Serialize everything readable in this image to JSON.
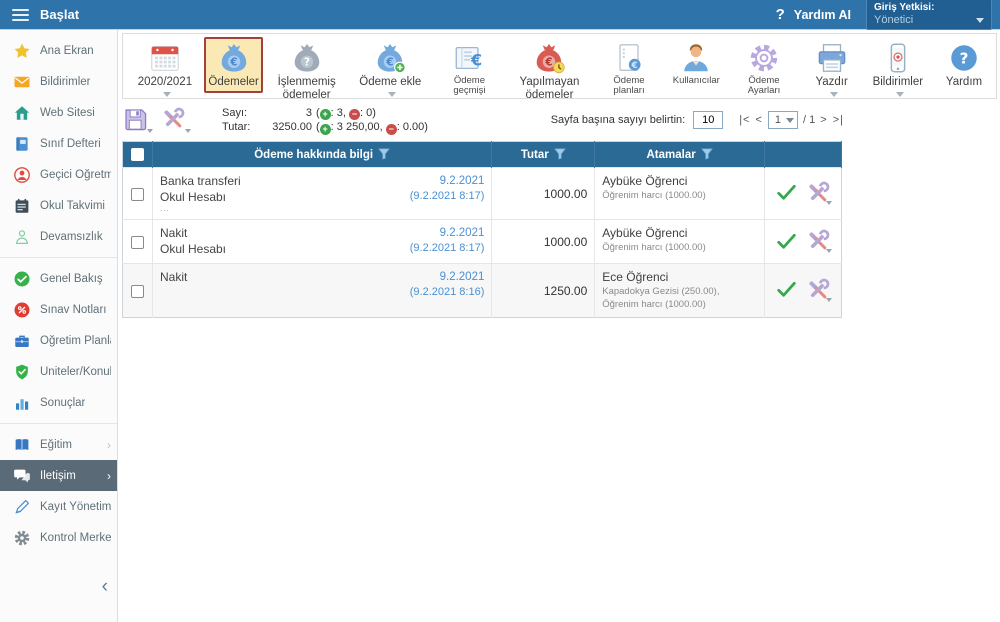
{
  "topbar": {
    "menu_label": "Başlat",
    "help_label": "Yardım AI",
    "role_label": "Giriş Yetkisi:",
    "role_value": "Yönetici"
  },
  "sidebar": {
    "collapse_glyph": "‹",
    "items": [
      {
        "id": "ana-ekran",
        "label": "Ana Ekran",
        "icon": "star-icon"
      },
      {
        "id": "bildirimler",
        "label": "Bildirimler",
        "icon": "mail-icon"
      },
      {
        "id": "web-sitesi",
        "label": "Web Sitesi",
        "icon": "home-icon"
      },
      {
        "id": "sinif-defteri",
        "label": "Sınıf Defteri",
        "icon": "notebook-icon"
      },
      {
        "id": "gecici-ogretmen",
        "label": "Geçici Öğretm...",
        "icon": "person-circle-icon"
      },
      {
        "id": "okul-takvimi",
        "label": "Okul Takvimi",
        "icon": "calendar-dark-icon"
      },
      {
        "id": "devamsizlik",
        "label": "Devamsızlık",
        "icon": "person-outline-icon",
        "divider_after": true
      },
      {
        "id": "genel-bakis",
        "label": "Genel Bakış",
        "icon": "check-circle-icon"
      },
      {
        "id": "sinav-notlari",
        "label": "Sınav Notları",
        "icon": "percent-circle-icon"
      },
      {
        "id": "ogretim-planlari",
        "label": "Öğretim Planları",
        "icon": "briefcase-icon"
      },
      {
        "id": "uniteler-konular",
        "label": "Üniteler/Konular",
        "icon": "shield-check-icon"
      },
      {
        "id": "sonuclar",
        "label": "Sonuçlar",
        "icon": "bar-chart-icon",
        "divider_after": true
      },
      {
        "id": "egitim",
        "label": "Eğitim",
        "icon": "open-book-icon",
        "chevron": true
      },
      {
        "id": "iletisim",
        "label": "İletişim",
        "icon": "chat-icon",
        "chevron": true,
        "selected": true
      },
      {
        "id": "kayit-yonetimi",
        "label": "Kayıt Yönetimi",
        "icon": "pen-icon"
      },
      {
        "id": "kontrol-merkezi",
        "label": "Kontrol Merkezi",
        "icon": "gear-gray-icon"
      }
    ]
  },
  "toolbar": {
    "items": [
      {
        "id": "year",
        "label": "2020/2021",
        "icon": "calendar-icon",
        "arrow": true
      },
      {
        "id": "odemeler",
        "label": "Ödemeler",
        "icon": "moneybag-euro-icon",
        "active": true
      },
      {
        "id": "islenmemis-odemeler",
        "label": "İşlenmemiş ödemeler",
        "icon": "moneybag-question-icon"
      },
      {
        "id": "odeme-ekle",
        "label": "Ödeme ekle",
        "icon": "moneybag-add-icon",
        "arrow": true
      },
      {
        "id": "odeme-gecmisi",
        "label": "Ödeme geçmişi",
        "icon": "ledger-euro-icon",
        "small": true
      },
      {
        "id": "yapilmayan-odemeler",
        "label": "Yapılmayan ödemeler",
        "icon": "moneybag-overdue-icon"
      },
      {
        "id": "odeme-planlari",
        "label": "Ödeme planları",
        "icon": "document-euro-icon",
        "small": true
      },
      {
        "id": "kullanicilar",
        "label": "Kullanıcılar",
        "icon": "user-icon",
        "small": true
      },
      {
        "id": "odeme-ayarlari",
        "label": "Ödeme Ayarları",
        "icon": "gear-purple-icon",
        "small": true
      },
      {
        "id": "yazdir",
        "label": "Yazdır",
        "icon": "printer-icon",
        "arrow": true
      },
      {
        "id": "bildirimler-tb",
        "label": "Bildirimler",
        "icon": "phone-icon",
        "arrow": true
      },
      {
        "id": "yardim",
        "label": "Yardım",
        "icon": "help-circle-icon"
      }
    ]
  },
  "controls": {
    "summary": {
      "sayi_label": "Sayı:",
      "sayi_value": "3",
      "sayi_pos": "3",
      "sayi_neg": "0",
      "tutar_label": "Tutar:",
      "tutar_value": "3250.00",
      "tutar_pos": "3 250,00",
      "tutar_neg": "0.00",
      "plus": "+",
      "minus": "−",
      "open_paren": "(",
      "close_paren": ")",
      "colon": ":",
      "comma": ","
    },
    "pagination": {
      "label": "Sayfa başına sayıyı belirtin:",
      "page_size": "10",
      "first": "|<",
      "prev": "<",
      "page": "1",
      "of": "/ 1",
      "next": ">",
      "last": ">|"
    }
  },
  "table": {
    "col_info": "Ödeme hakkında bilgi",
    "col_tutar": "Tutar",
    "col_atamalar": "Atamalar",
    "rows": [
      {
        "method": "Banka transferi",
        "account": "Okul Hesabı",
        "note": "...",
        "date": "9.2.2021",
        "datetime": "(9.2.2021 8:17)",
        "amount": "1000.00",
        "student": "Aybüke Öğrenci",
        "items": "Öğrenim harcı (1000.00)"
      },
      {
        "method": "Nakit",
        "account": "Okul Hesabı",
        "note": "",
        "date": "9.2.2021",
        "datetime": "(9.2.2021 8:17)",
        "amount": "1000.00",
        "student": "Aybüke Öğrenci",
        "items": "Öğrenim harcı (1000.00)"
      },
      {
        "method": "Nakit",
        "account": "",
        "note": "",
        "date": "9.2.2021",
        "datetime": "(9.2.2021 8:16)",
        "amount": "1250.00",
        "student": "Ece Öğrenci",
        "items": "Kapadokya Gezisi (250.00), Öğrenim harcı (1000.00)"
      }
    ]
  },
  "colors": {
    "topbar": "#2e74ab",
    "table_header": "#2c6a96",
    "active_item_bg": "#fbe9b5",
    "active_item_border": "#a43f3f",
    "link": "#4a90d2",
    "positive": "#3da44d",
    "negative": "#cc4b4b",
    "selected_sidebar": "#5a6b77"
  }
}
